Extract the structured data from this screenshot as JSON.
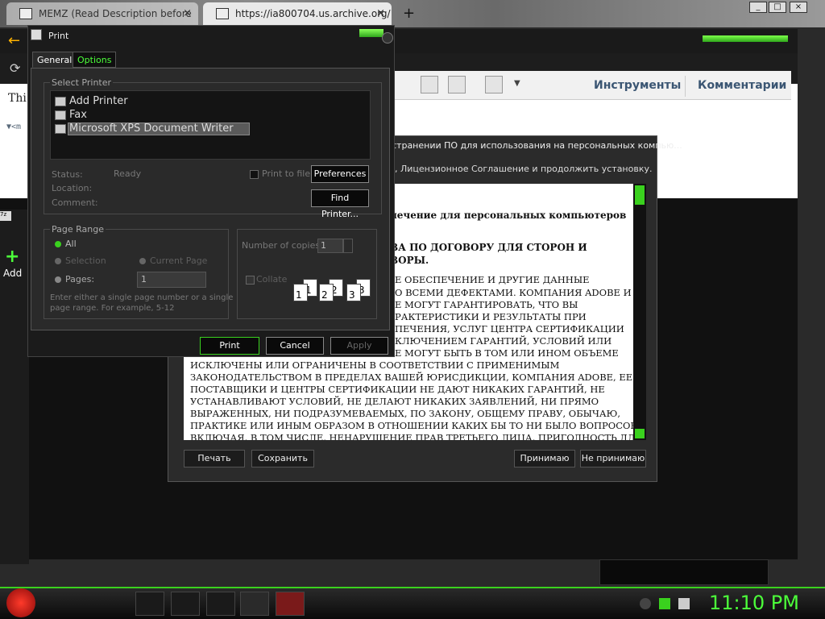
{
  "browser": {
    "tabs": [
      {
        "title": "MEMZ (Read Description before",
        "close": "×"
      },
      {
        "title": "https://ia800704.us.archive.org/1",
        "close": "×"
      }
    ],
    "new_tab": "+",
    "back": "←",
    "reload": "⟳"
  },
  "page": {
    "text1": "Thi",
    "text2": "▼<m"
  },
  "acrobat": {
    "tools": "Инструменты",
    "comments": "Комментарии"
  },
  "adobe_dialog": {
    "title_fragment": "странении ПО для использования на персональных компью...",
    "subtitle_fragment": ", Лицензионное Соглашение и продолжить установку.",
    "doc_lines": [
      {
        "text": "печение для персональных компьютеров",
        "bold": true
      },
      {
        "text": "ВА ПО ДОГОВОРУ ДЛЯ СТОРОН И",
        "bold": true
      },
      {
        "text": "ВОРЫ.",
        "bold": true
      },
      {
        "text": "Е ОБЕСПЕЧЕНИЕ И ДРУГИЕ ДАННЫЕ",
        "bold": false
      },
      {
        "text": "О ВСЕМИ ДЕФЕКТАМИ. КОМПАНИЯ ADOBE И",
        "bold": false
      },
      {
        "text": "Е МОГУТ ГАРАНТИРОВАТЬ, ЧТО ВЫ",
        "bold": false
      },
      {
        "text": "РАКТЕРИСТИКИ И РЕЗУЛЬТАТЫ ПРИ",
        "bold": false
      },
      {
        "text": "ПЕЧЕНИЯ, УСЛУГ ЦЕНТРА СЕРТИФИКАЦИИ",
        "bold": false
      },
      {
        "text": "КЛЮЧЕНИЕМ ГАРАНТИЙ, УСЛОВИЙ ИЛИ",
        "bold": false
      },
      {
        "text": "Е МОГУТ БЫТЬ В ТОМ ИЛИ ИНОМ ОБЪЕМЕ",
        "bold": false
      },
      {
        "text": "ИСКЛЮЧЕНЫ ИЛИ ОГРАНИЧЕНЫ В СООТВЕТСТВИИ С ПРИМЕНИМЫМ",
        "bold": false
      },
      {
        "text": "ЗАКОНОДАТЕЛЬСТВОМ В ПРЕДЕЛАХ ВАШЕЙ ЮРИСДИКЦИИ, КОМПАНИЯ ADOBE, ЕЕ",
        "bold": false
      },
      {
        "text": "ПОСТАВЩИКИ И ЦЕНТРЫ СЕРТИФИКАЦИИ НЕ ДАЮТ НИКАКИХ ГАРАНТИЙ, НЕ",
        "bold": false
      },
      {
        "text": "УСТАНАВЛИВАЮТ УСЛОВИЙ, НЕ ДЕЛАЮТ НИКАКИХ ЗАЯВЛЕНИЙ, НИ ПРЯМО",
        "bold": false
      },
      {
        "text": "ВЫРАЖЕННЫХ, НИ ПОДРАЗУМЕВАЕМЫХ, ПО ЗАКОНУ, ОБЩЕМУ ПРАВУ, ОБЫЧАЮ,",
        "bold": false
      },
      {
        "text": "ПРАКТИКЕ ИЛИ ИНЫМ ОБРАЗОМ В ОТНОШЕНИИ КАКИХ БЫ ТО НИ БЫЛО ВОПРОСОВ,",
        "bold": false
      },
      {
        "text": "ВКЛЮЧАЯ, В ТОМ ЧИСЛЕ, НЕНАРУШЕНИЕ ПРАВ ТРЕТЬЕГО ЛИЦА, ПРИГОДНОСТЬ ДЛЯ",
        "bold": false
      }
    ],
    "buttons": {
      "print": "Печать",
      "save": "Сохранить",
      "accept": "Принимаю",
      "decline": "Не принимаю"
    }
  },
  "print_dialog": {
    "title": "Print",
    "tabs": {
      "general": "General",
      "options": "Options"
    },
    "select_printer_label": "Select Printer",
    "printers": [
      "Add Printer",
      "Fax",
      "Microsoft XPS Document Writer"
    ],
    "status_label": "Status:",
    "status_value": "Ready",
    "location_label": "Location:",
    "comment_label": "Comment:",
    "print_to_file": "Print to file",
    "preferences": "Preferences",
    "find_printer": "Find Printer...",
    "page_range_label": "Page Range",
    "all": "All",
    "selection": "Selection",
    "current_page": "Current Page",
    "pages": "Pages:",
    "pages_value": "1",
    "hint1": "Enter either a single page number or a single",
    "hint2": "page range.  For example, 5-12",
    "copies_label": "Number of copies:",
    "copies_value": "1",
    "collate": "Collate",
    "collate_pages": [
      "1",
      "1",
      "2",
      "2",
      "3",
      "3"
    ],
    "buttons": {
      "print": "Print",
      "cancel": "Cancel",
      "apply": "Apply"
    }
  },
  "left_app": {
    "add": "Add",
    "sevenzip": "7z"
  },
  "taskbar": {
    "clock": "11:10 PM"
  }
}
